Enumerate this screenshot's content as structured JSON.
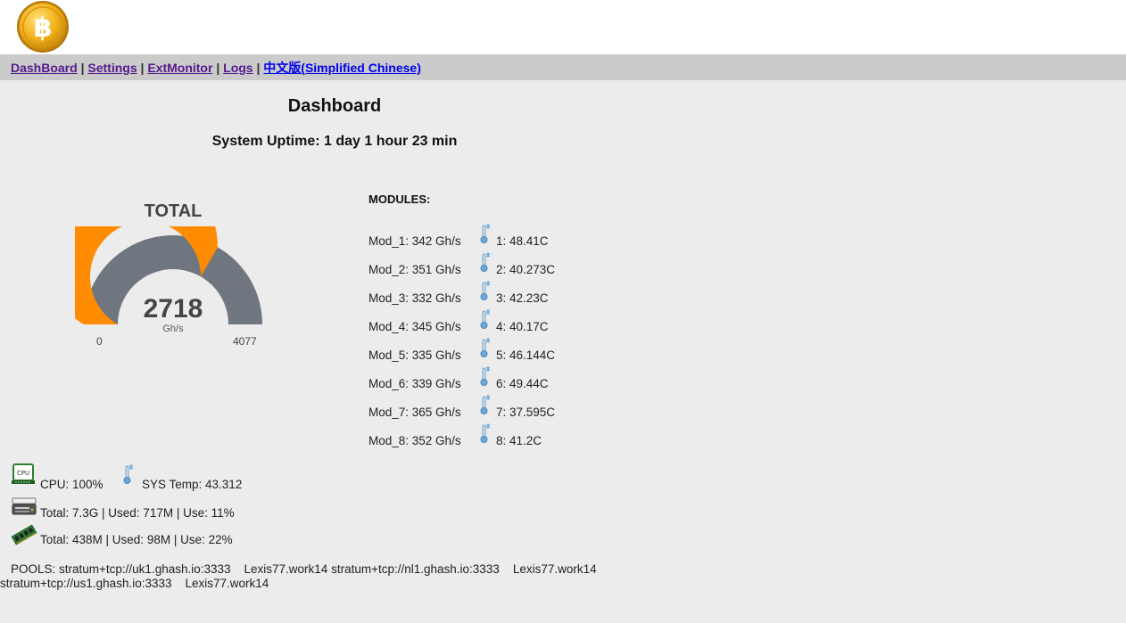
{
  "nav": {
    "items": [
      {
        "label": "DashBoard"
      },
      {
        "label": "Settings"
      },
      {
        "label": "ExtMonitor"
      },
      {
        "label": "Logs"
      },
      {
        "label": "中文版(Simplified Chinese)"
      }
    ],
    "separator": "|"
  },
  "header": {
    "title": "Dashboard",
    "uptime": "System Uptime: 1 day 1 hour 23 min"
  },
  "gauge": {
    "title": "TOTAL",
    "value": "2718",
    "unit": "Gh/s",
    "min": "0",
    "max": "4077",
    "fill_color": "#ff8c00",
    "track_color": "#707680"
  },
  "modules": {
    "title": "MODULES:",
    "items": [
      {
        "label": "Mod_1: 342 Gh/s",
        "temp": "1: 48.41C"
      },
      {
        "label": "Mod_2: 351 Gh/s",
        "temp": "2: 40.273C"
      },
      {
        "label": "Mod_3: 332 Gh/s",
        "temp": "3: 42.23C"
      },
      {
        "label": "Mod_4: 345 Gh/s",
        "temp": "4: 40.17C"
      },
      {
        "label": "Mod_5: 335 Gh/s",
        "temp": "5: 46.144C"
      },
      {
        "label": "Mod_6: 339 Gh/s",
        "temp": "6: 49.44C"
      },
      {
        "label": "Mod_7: 365 Gh/s",
        "temp": "7: 37.595C"
      },
      {
        "label": "Mod_8: 352 Gh/s",
        "temp": "8: 41.2C"
      }
    ]
  },
  "system": {
    "cpu": "CPU: 100%",
    "sys_temp": "SYS Temp: 43.312",
    "disk": "Total: 7.3G | Used: 717M | Use: 11%",
    "memory": "Total: 438M | Used: 98M | Use: 22%"
  },
  "pools": {
    "line1": "POOLS: stratum+tcp://uk1.ghash.io:3333    Lexis77.work14 stratum+tcp://nl1.ghash.io:3333    Lexis77.work14",
    "line2": "stratum+tcp://us1.ghash.io:3333    Lexis77.work14"
  },
  "icons": {
    "logo": "bitcoin-logo-icon",
    "thermometer": "thermometer-icon",
    "cpu": "cpu-chip-icon",
    "disk": "hard-drive-icon",
    "memory": "memory-module-icon"
  }
}
